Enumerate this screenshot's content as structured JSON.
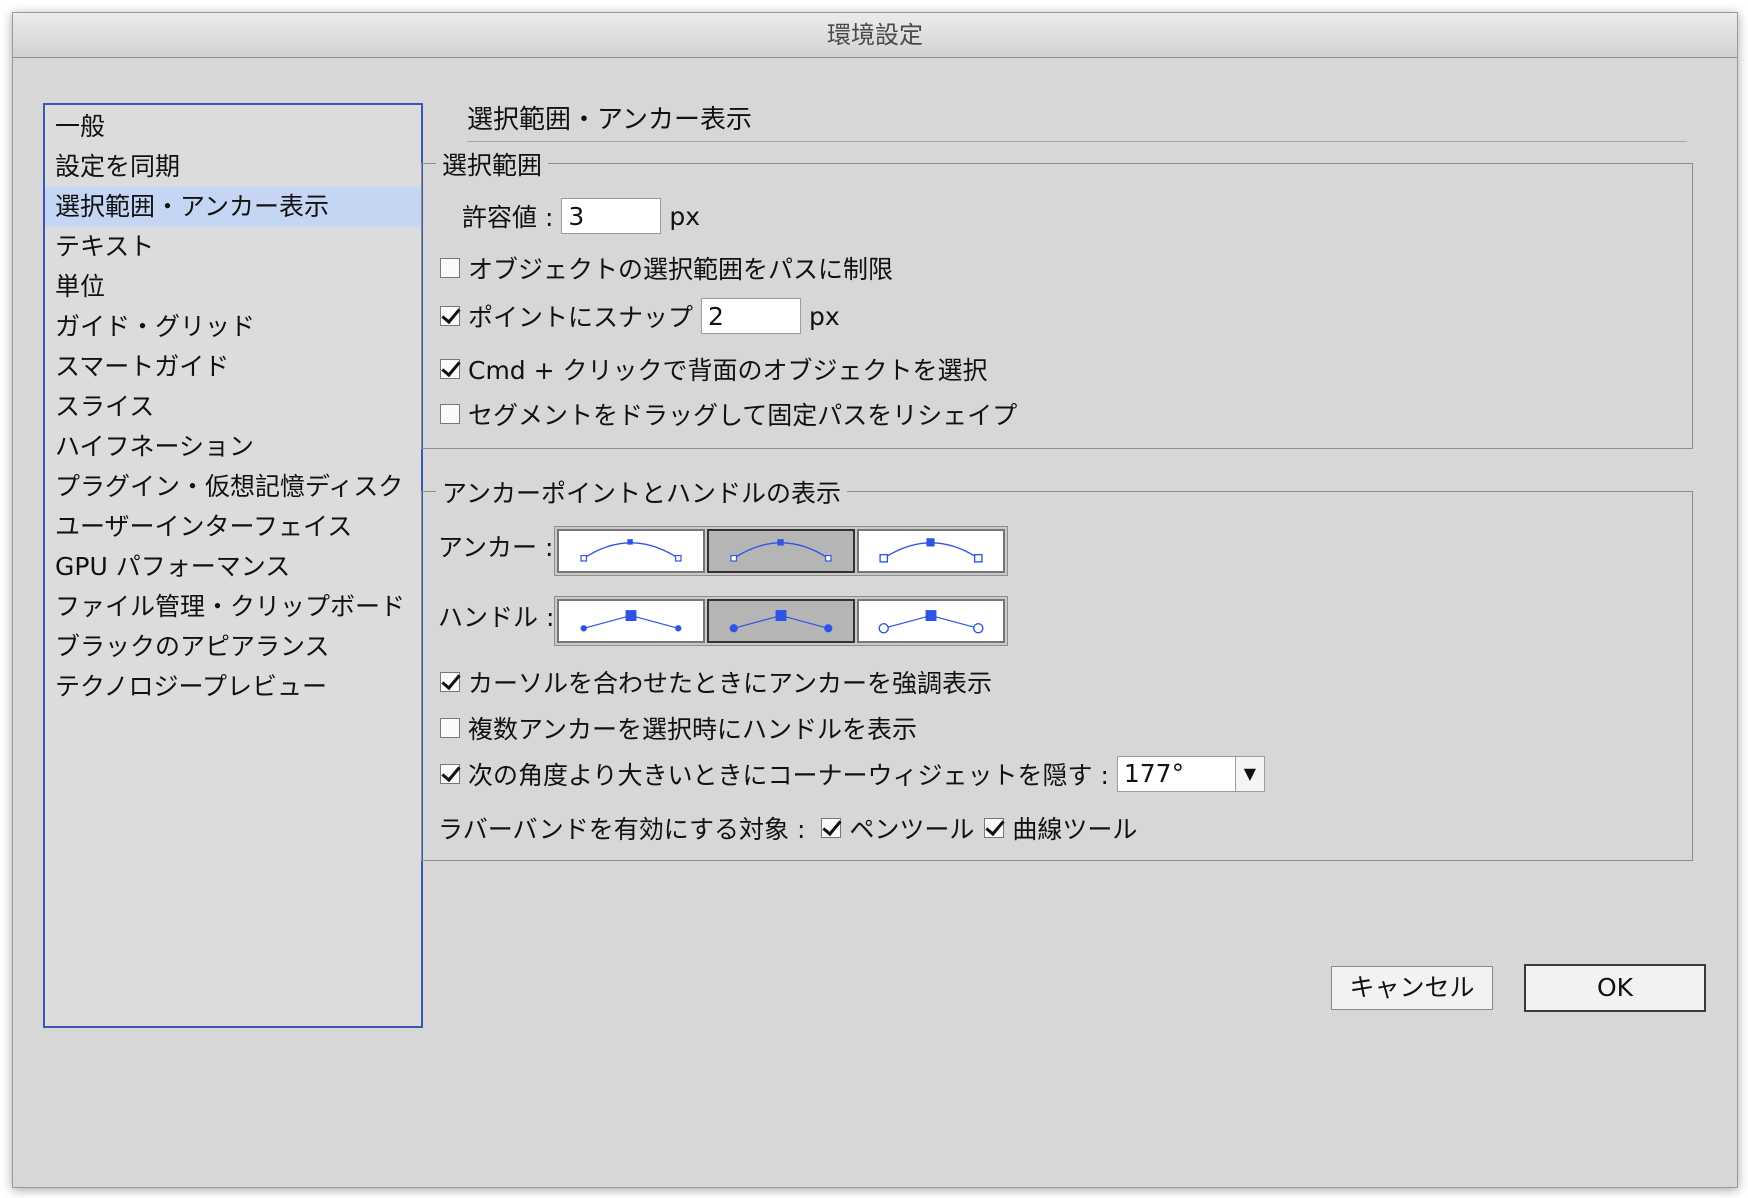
{
  "window": {
    "title": "環境設定"
  },
  "sidebar": {
    "items": [
      "一般",
      "設定を同期",
      "選択範囲・アンカー表示",
      "テキスト",
      "単位",
      "ガイド・グリッド",
      "スマートガイド",
      "スライス",
      "ハイフネーション",
      "プラグイン・仮想記憶ディスク",
      "ユーザーインターフェイス",
      "GPU パフォーマンス",
      "ファイル管理・クリップボード",
      "ブラックのアピアランス",
      "テクノロジープレビュー"
    ],
    "selected_index": 2
  },
  "main": {
    "section_title": "選択範囲・アンカー表示",
    "selection_group": {
      "legend": "選択範囲",
      "tolerance_label": "許容値 :",
      "tolerance_value": "3",
      "tolerance_unit": "px",
      "restrict_label": "オブジェクトの選択範囲をパスに制限",
      "restrict_checked": false,
      "snap_label": "ポイントにスナップ",
      "snap_checked": true,
      "snap_value": "2",
      "snap_unit": "px",
      "cmd_label": "Cmd + クリックで背面のオブジェクトを選択",
      "cmd_checked": true,
      "reshape_label": "セグメントをドラッグして固定パスをリシェイプ",
      "reshape_checked": false
    },
    "anchor_group": {
      "legend": "アンカーポイントとハンドルの表示",
      "anchor_label": "アンカー :",
      "anchor_selected_index": 1,
      "handle_label": "ハンドル :",
      "handle_selected_index": 1,
      "highlight_label": "カーソルを合わせたときにアンカーを強調表示",
      "highlight_checked": true,
      "show_handles_label": "複数アンカーを選択時にハンドルを表示",
      "show_handles_checked": false,
      "hide_widget_label": "次の角度より大きいときにコーナーウィジェットを隠す :",
      "hide_widget_checked": true,
      "hide_widget_value": "177°",
      "rubber_band_label": "ラバーバンドを有効にする対象 :",
      "pen_tool_label": "ペンツール",
      "pen_tool_checked": true,
      "curvature_tool_label": "曲線ツール",
      "curvature_tool_checked": true
    }
  },
  "buttons": {
    "cancel": "キャンセル",
    "ok": "OK"
  },
  "colors": {
    "accent": "#3a57b5",
    "selection_bg": "#c5d6f4",
    "icon_blue": "#2d54e6"
  }
}
